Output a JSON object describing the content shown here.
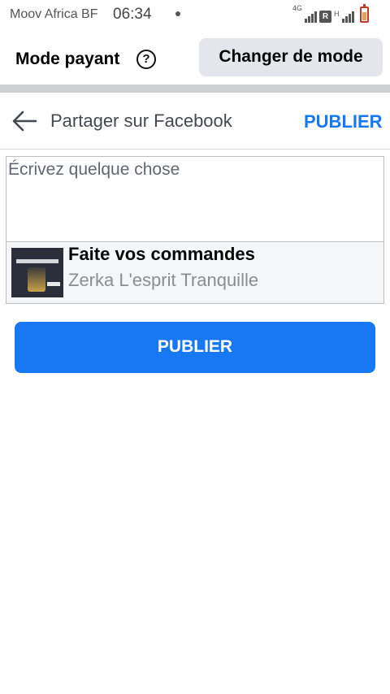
{
  "status_bar": {
    "carrier": "Moov Africa BF",
    "time": "06:34",
    "network_type": "4G",
    "roaming_badge": "R",
    "hspa_label": "H",
    "icons": [
      "signal-icon",
      "signal-icon",
      "battery-icon"
    ]
  },
  "mode_bar": {
    "label": "Mode payant",
    "help_glyph": "?",
    "change_button": "Changer de mode"
  },
  "header": {
    "title": "Partager sur Facebook",
    "publish_link": "PUBLIER",
    "back_icon": "arrow-left-icon"
  },
  "composer": {
    "placeholder": "Écrivez quelque chose",
    "value": ""
  },
  "link_preview": {
    "title": "Faite vos commandes",
    "subtitle": "Zerka L'esprit Tranquille",
    "thumbnail": "coffee-machine-ad-image"
  },
  "publish_button": "PUBLIER",
  "colors": {
    "accent": "#1877f2",
    "button_gray": "#e4e6eb",
    "divider": "#ced0d4"
  }
}
